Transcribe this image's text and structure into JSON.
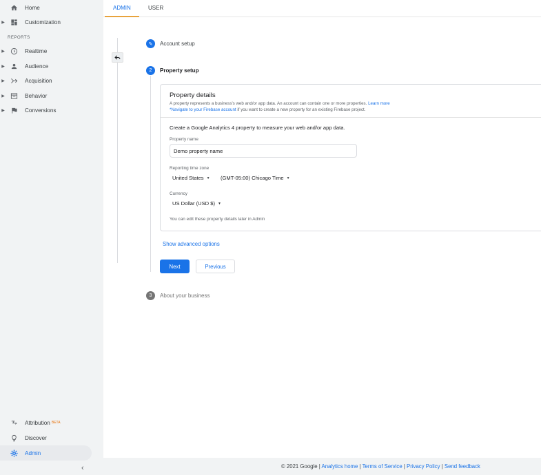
{
  "sidebar": {
    "home": "Home",
    "customization": "Customization",
    "reports_header": "REPORTS",
    "items": [
      {
        "label": "Realtime",
        "icon": "clock-icon"
      },
      {
        "label": "Audience",
        "icon": "person-icon"
      },
      {
        "label": "Acquisition",
        "icon": "acquisition-icon"
      },
      {
        "label": "Behavior",
        "icon": "behavior-icon"
      },
      {
        "label": "Conversions",
        "icon": "flag-icon"
      }
    ],
    "attribution": "Attribution",
    "attribution_badge": "BETA",
    "discover": "Discover",
    "admin": "Admin",
    "collapse_glyph": "‹"
  },
  "tabs": [
    {
      "label": "ADMIN",
      "active": true
    },
    {
      "label": "USER",
      "active": false
    }
  ],
  "steps": [
    {
      "number": "✎",
      "label": "Account setup",
      "state": "done"
    },
    {
      "number": "2",
      "label": "Property setup",
      "state": "active"
    },
    {
      "number": "3",
      "label": "About your business",
      "state": "pending"
    }
  ],
  "property_details": {
    "title": "Property details",
    "desc_line1": "A property represents a business's web and/or app data. An account can contain one or more properties.",
    "learn_more": "Learn more",
    "firebase_link": "*Navigate to your Firebase account",
    "desc_line2_rest": " if you want to create a new property for an existing Firebase project.",
    "ga4_text": "Create a Google Analytics 4 property to measure your web and/or app data.",
    "property_name_label": "Property name",
    "property_name_value": "Demo property name",
    "timezone_label": "Reporting time zone",
    "country": "United States",
    "timezone": "(GMT-05:00) Chicago Time",
    "currency_label": "Currency",
    "currency": "US Dollar (USD $)",
    "hint": "You can edit these property details later in Admin"
  },
  "actions": {
    "advanced": "Show advanced options",
    "next": "Next",
    "previous": "Previous"
  },
  "footer": {
    "copyright": "© 2021 Google",
    "analytics_home": "Analytics home",
    "terms": "Terms of Service",
    "privacy": "Privacy Policy",
    "feedback": "Send feedback",
    "separator": " | "
  },
  "colors": {
    "accent": "#1a73e8",
    "tab_underline": "#e8a33d",
    "step_pending": "#757575"
  }
}
